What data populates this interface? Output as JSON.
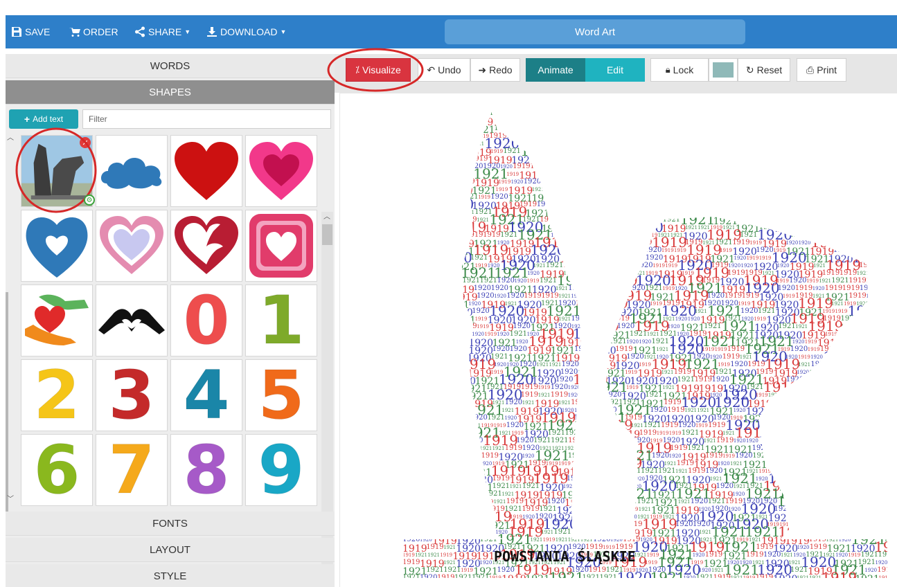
{
  "topbar": {
    "save_label": "SAVE",
    "order_label": "ORDER",
    "share_label": "SHARE",
    "download_label": "DOWNLOAD",
    "title": "Word Art"
  },
  "leftpanel": {
    "words_label": "WORDS",
    "shapes_label": "SHAPES",
    "add_text_label": "Add text",
    "filter_placeholder": "Filter",
    "fonts_label": "FONTS",
    "layout_label": "LAYOUT",
    "style_label": "STYLE"
  },
  "shapes": {
    "zero": "0",
    "one": "1",
    "two": "2",
    "three": "3",
    "four": "4",
    "five": "5",
    "six": "6",
    "seven": "7",
    "eight": "8",
    "nine": "9"
  },
  "toolbar": {
    "visualize_label": "Visualize",
    "undo_label": "Undo",
    "redo_label": "Redo",
    "animate_label": "Animate",
    "edit_label": "Edit",
    "lock_label": "Lock",
    "reset_label": "Reset",
    "print_label": "Print"
  },
  "wordcloud": {
    "words": [
      "1919",
      "1920",
      "1921"
    ],
    "feature_text": "POWSTANIA ŚLĄSKIE",
    "colors": [
      "#d93a3a",
      "#3a3fb5",
      "#3d8a4a"
    ]
  },
  "colors": {
    "topbar": "#2e7fc9",
    "visualize": "#d9343f",
    "animate": "#1c7f87",
    "edit": "#1fb3c0",
    "add_text": "#1fa2b2",
    "swatch": "#8fb9b8",
    "highlight_circle": "#d62828"
  }
}
